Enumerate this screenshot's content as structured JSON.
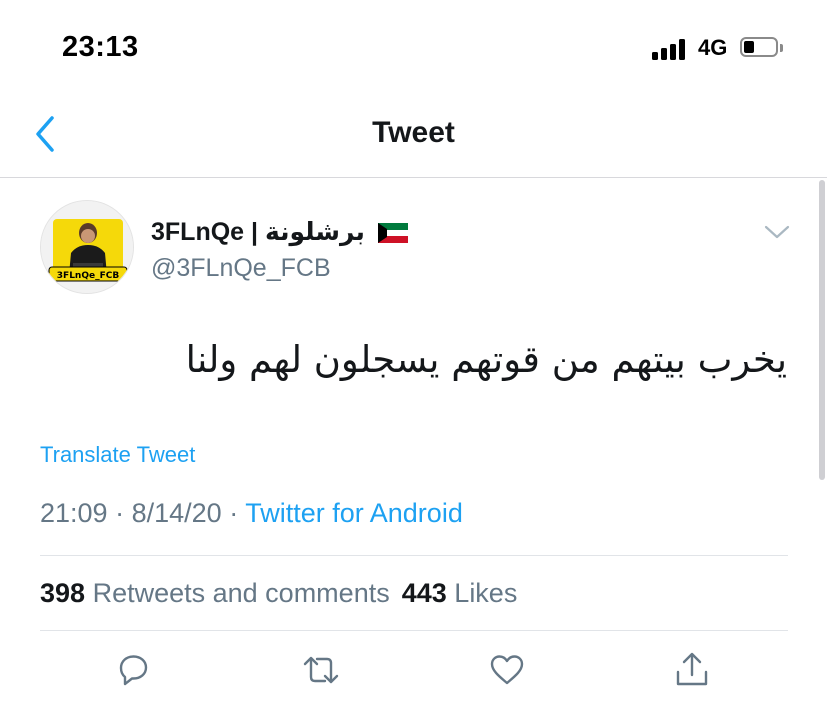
{
  "status_bar": {
    "time": "23:13",
    "network": "4G"
  },
  "nav": {
    "title": "Tweet"
  },
  "tweet": {
    "display_name": "3FLnQe | برشلونة",
    "username": "@3FLnQe_FCB",
    "text": "يخرب بيتهم من قوتهم يسجلون لهم ولنا",
    "translate_label": "Translate Tweet",
    "time": "21:09",
    "date": "8/14/20",
    "separator": "·",
    "source": "Twitter for Android",
    "retweets_count": "398",
    "retweets_label": "Retweets and comments",
    "likes_count": "443",
    "likes_label": "Likes",
    "avatar_text": "3FLnQe_FCB"
  },
  "colors": {
    "accent": "#1da1f2",
    "secondary_text": "#657786",
    "primary_text": "#14171a"
  },
  "icons": {
    "back": "chevron-left-icon",
    "caret": "chevron-down-icon",
    "flag": "kuwait-flag-icon",
    "actions": [
      "reply-icon",
      "retweet-icon",
      "like-icon",
      "share-icon"
    ]
  }
}
